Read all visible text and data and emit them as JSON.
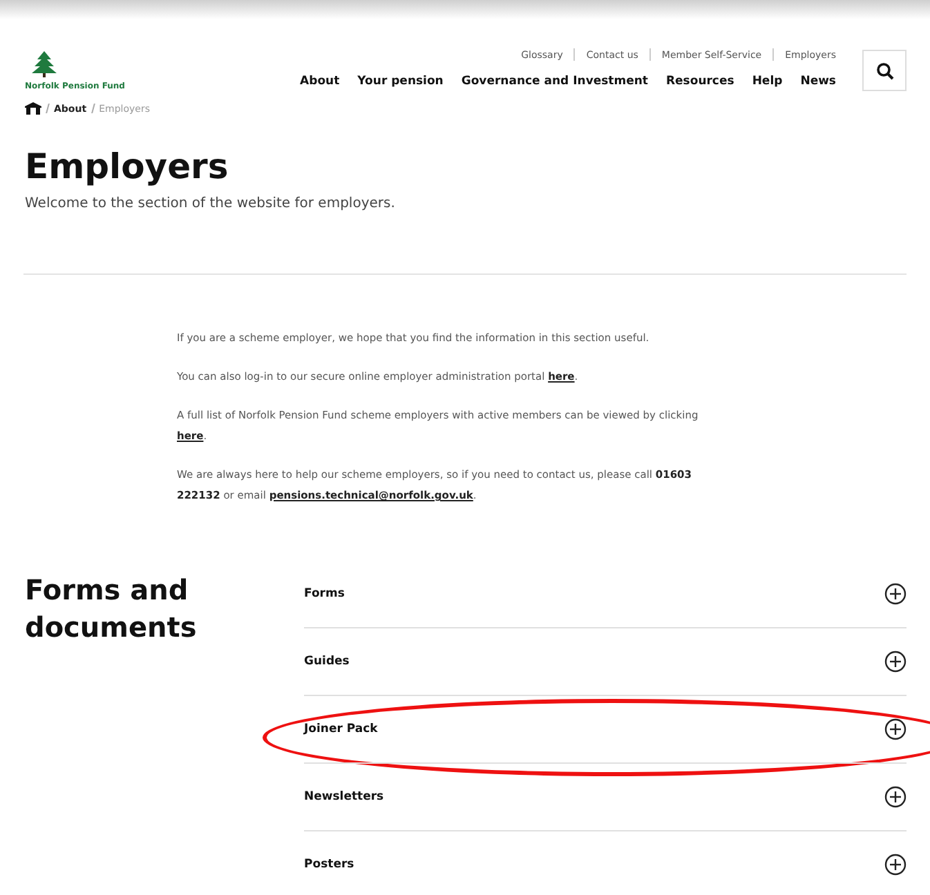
{
  "logo": {
    "text": "Norfolk Pension Fund"
  },
  "utility_nav": [
    "Glossary",
    "Contact us",
    "Member Self-Service",
    "Employers"
  ],
  "main_nav": [
    "About",
    "Your pension",
    "Governance and Investment",
    "Resources",
    "Help",
    "News"
  ],
  "breadcrumb": [
    "About",
    "Employers"
  ],
  "page": {
    "title": "Employers",
    "intro": "Welcome to the section of the website for employers."
  },
  "paragraphs": [
    [
      {
        "kind": "text",
        "text": "If you are a scheme employer, we hope that you find the information in this section useful."
      }
    ],
    [
      {
        "kind": "text",
        "text": "You can also log-in to our secure online employer administration portal "
      },
      {
        "kind": "link",
        "text": "here"
      },
      {
        "kind": "text",
        "text": "."
      }
    ],
    [
      {
        "kind": "text",
        "text": "A full list of Norfolk Pension Fund scheme employers with active members can be viewed by clicking "
      },
      {
        "kind": "link",
        "text": "here"
      },
      {
        "kind": "text",
        "text": "."
      }
    ],
    [
      {
        "kind": "text",
        "text": "We are always here to help our scheme employers, so if you need to contact us, please call "
      },
      {
        "kind": "bold",
        "text": "01603 222132"
      },
      {
        "kind": "text",
        "text": " or email "
      },
      {
        "kind": "link",
        "text": "pensions.technical@norfolk.gov.uk"
      },
      {
        "kind": "text",
        "text": "."
      }
    ]
  ],
  "section": {
    "title": "Forms and documents",
    "items": [
      {
        "label": "Forms",
        "expanded": false,
        "highlighted": false
      },
      {
        "label": "Guides",
        "expanded": false,
        "highlighted": false
      },
      {
        "label": "Joiner Pack",
        "expanded": false,
        "highlighted": true
      },
      {
        "label": "Newsletters",
        "expanded": false,
        "highlighted": false
      },
      {
        "label": "Posters",
        "expanded": false,
        "highlighted": false
      }
    ]
  }
}
